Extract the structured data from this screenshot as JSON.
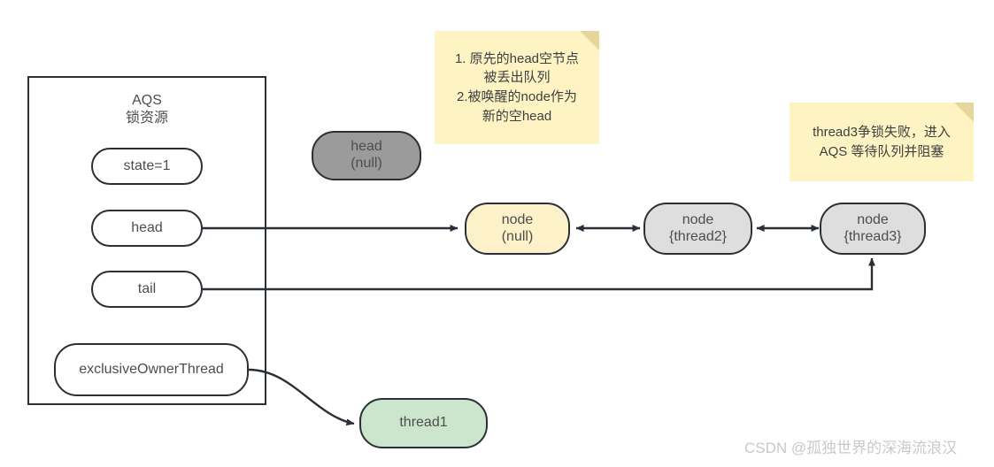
{
  "diagram": {
    "title_note": "AQS lock resource queue state diagram",
    "aqs": {
      "title_line1": "AQS",
      "title_line2": "锁资源",
      "fields": [
        {
          "id": "state",
          "label": "state=1"
        },
        {
          "id": "head",
          "label": "head"
        },
        {
          "id": "tail",
          "label": "tail"
        },
        {
          "id": "owner",
          "label": "exclusiveOwnerThread"
        }
      ]
    },
    "nodes": {
      "old_head": {
        "line1": "head",
        "line2": "(null)",
        "fill": "#9b9b9b"
      },
      "node_null": {
        "line1": "node",
        "line2": "(null)",
        "fill": "#fcf1c8"
      },
      "node_thread2": {
        "line1": "node",
        "line2": "{thread2}",
        "fill": "#dedede"
      },
      "node_thread3": {
        "line1": "node",
        "line2": "{thread3}",
        "fill": "#dedede"
      },
      "thread1": {
        "line1": "thread1",
        "line2": "",
        "fill": "#cce5cd"
      }
    },
    "notes": {
      "note1": {
        "lines": [
          "1. 原先的head空节点",
          "被丢出队列",
          "2.被唤醒的node作为",
          "新的空head"
        ]
      },
      "note2": {
        "lines": [
          "thread3争锁失败，进入",
          "AQS 等待队列并阻塞"
        ]
      }
    },
    "watermark": "CSDN @孤独世界的深海流浪汉",
    "colors": {
      "stroke": "#2b3036",
      "text": "#4d4d4d",
      "sticky_bg": "#fdf3c3",
      "sticky_fold": "#e6d69a",
      "gray_dark": "#9b9b9b",
      "gray_light": "#dedede",
      "yellow_node": "#fcf1c8",
      "green_node": "#cce5cd",
      "watermark": "#c9c9c9"
    }
  }
}
